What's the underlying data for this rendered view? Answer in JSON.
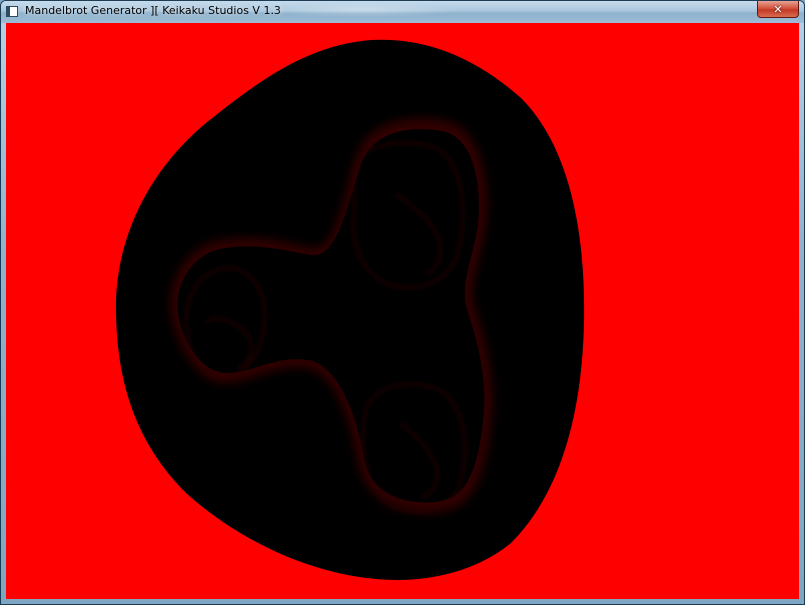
{
  "window": {
    "title": "Mandelbrot Generator ][ Keikaku Studios V 1.3",
    "app_icon": "window-app-icon",
    "close_icon": "close-x-icon",
    "close_glyph": "✕"
  },
  "canvas": {
    "background_color": "#ff0000",
    "set_color": "#000000",
    "glow_color": "#3a0000",
    "filament_color": "#2a0000"
  }
}
